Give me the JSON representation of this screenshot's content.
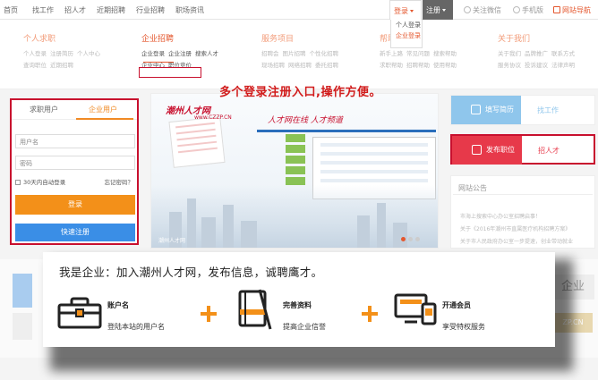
{
  "topnav": {
    "items": [
      "首页",
      "找工作",
      "招人才",
      "近期招聘",
      "行业招聘",
      "职场资讯"
    ],
    "login_label": "登录",
    "register_label": "注册",
    "right_links": [
      "关注微信",
      "手机版",
      "网站导航"
    ]
  },
  "login_dropdown": [
    "个人登录",
    "企业登录"
  ],
  "megamenu": [
    {
      "title": "个人求职",
      "links": [
        [
          "个人登录",
          "注册简历",
          "个人中心"
        ],
        [
          "查询职位",
          "近期招聘"
        ]
      ]
    },
    {
      "title": "企业招聘",
      "links": [
        [
          "企业登录",
          "企业注册",
          "搜索人才"
        ],
        [
          "企业中心",
          "职位竞价"
        ]
      ]
    },
    {
      "title": "服务项目",
      "links": [
        [
          "招聘会",
          "图片招聘",
          "个性化招聘"
        ],
        [
          "现场招聘",
          "网络招聘",
          "委托招聘"
        ]
      ]
    },
    {
      "title": "帮助",
      "links": [
        [
          "新手上路",
          "常见问题",
          "搜索帮助"
        ],
        [
          "求职帮助",
          "招聘帮助",
          "使用帮助"
        ]
      ]
    },
    {
      "title": "关于我们",
      "links": [
        [
          "关于我们",
          "品牌推广",
          "联系方式"
        ],
        [
          "服务协议",
          "投诉建议",
          "法律声明"
        ]
      ]
    }
  ],
  "annotation_top": "多个登录注册入口,操作方便。",
  "login_panel": {
    "tab_jobseeker": "求职用户",
    "tab_company": "企业用户",
    "username_placeholder": "用户名",
    "password_placeholder": "密码",
    "remember_label": "30天内自动登录",
    "forgot_label": "忘记密码？",
    "login_button": "登录",
    "quick_register_button": "快速注册"
  },
  "banner": {
    "logo": "潮州人才网",
    "logo_sub": "www.CZZP.CN",
    "slogan": "人才网在线  人才频道",
    "caption": "潮州人才网"
  },
  "sidebar": {
    "resume_left": "填写简历",
    "resume_right": "找工作",
    "job_left": "发布职位",
    "job_right": "招人才",
    "notice_title": "网站公告",
    "notices": [
      "市海上搜索中心办公室招聘启事！",
      "关于《2016年潮州市直属医疗机构招聘方案》",
      "关于市人民政府办公室一步提速，创业带动就业"
    ]
  },
  "lower": {
    "logo_text": "企业",
    "logo_text2": "ZP.CN"
  },
  "callout": {
    "headline": "我是企业：加入潮州人才网，发布信息，诚聘鹰才。",
    "steps": [
      {
        "title": "账户名",
        "desc": "登陆本站的用户名"
      },
      {
        "title": "完善资料",
        "desc": "提高企业信誉"
      },
      {
        "title": "开通会员",
        "desc": "享受特权服务"
      }
    ]
  }
}
